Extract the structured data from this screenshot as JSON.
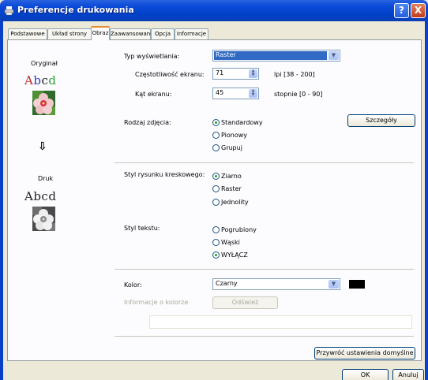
{
  "window": {
    "title": "Preferencje drukowania",
    "help_icon": "?",
    "close_icon": "X"
  },
  "tabs": [
    {
      "label": "Podstawowe"
    },
    {
      "label": "Układ strony"
    },
    {
      "label": "Obraz"
    },
    {
      "label": "Zaawansowane"
    },
    {
      "label": "Opcja"
    },
    {
      "label": "Informacje"
    }
  ],
  "preview": {
    "original_label": "Oryginał",
    "sample_text": "Abcd",
    "arrow": "⇩",
    "print_label": "Druk",
    "print_sample_text": "Abcd"
  },
  "display": {
    "type_label": "Typ wyświetlania:",
    "type_value": "Raster",
    "frequency_label": "Częstotliwość ekranu:",
    "frequency_value": "71",
    "frequency_range": "lpi [38 - 200]",
    "angle_label": "Kąt ekranu:",
    "angle_value": "45",
    "angle_range": "stopnie [0 - 90]"
  },
  "photo": {
    "label": "Rodzaj zdjęcia:",
    "options": [
      {
        "label": "Standardowy",
        "checked": true
      },
      {
        "label": "Pionowy",
        "checked": false
      },
      {
        "label": "Grupuj",
        "checked": false
      }
    ],
    "details_button": "Szczegóły"
  },
  "line_art": {
    "label": "Styl rysunku kreskowego:",
    "options": [
      {
        "label": "Ziarno",
        "checked": true
      },
      {
        "label": "Raster",
        "checked": false
      },
      {
        "label": "Jednolity",
        "checked": false
      }
    ]
  },
  "text_style": {
    "label": "Styl tekstu:",
    "options": [
      {
        "label": "Pogrubiony",
        "checked": false
      },
      {
        "label": "Wąski",
        "checked": false
      },
      {
        "label": "WYŁĄCZ",
        "checked": true
      }
    ]
  },
  "color": {
    "label": "Kolor:",
    "value": "Czarny",
    "swatch": "#000000",
    "info_label": "Informacje o kolorze",
    "refresh_button": "Odśwież"
  },
  "footer": {
    "restore_button": "Przywróć ustawienia domyślne",
    "ok_button": "OK",
    "cancel_button": "Anuluj"
  }
}
